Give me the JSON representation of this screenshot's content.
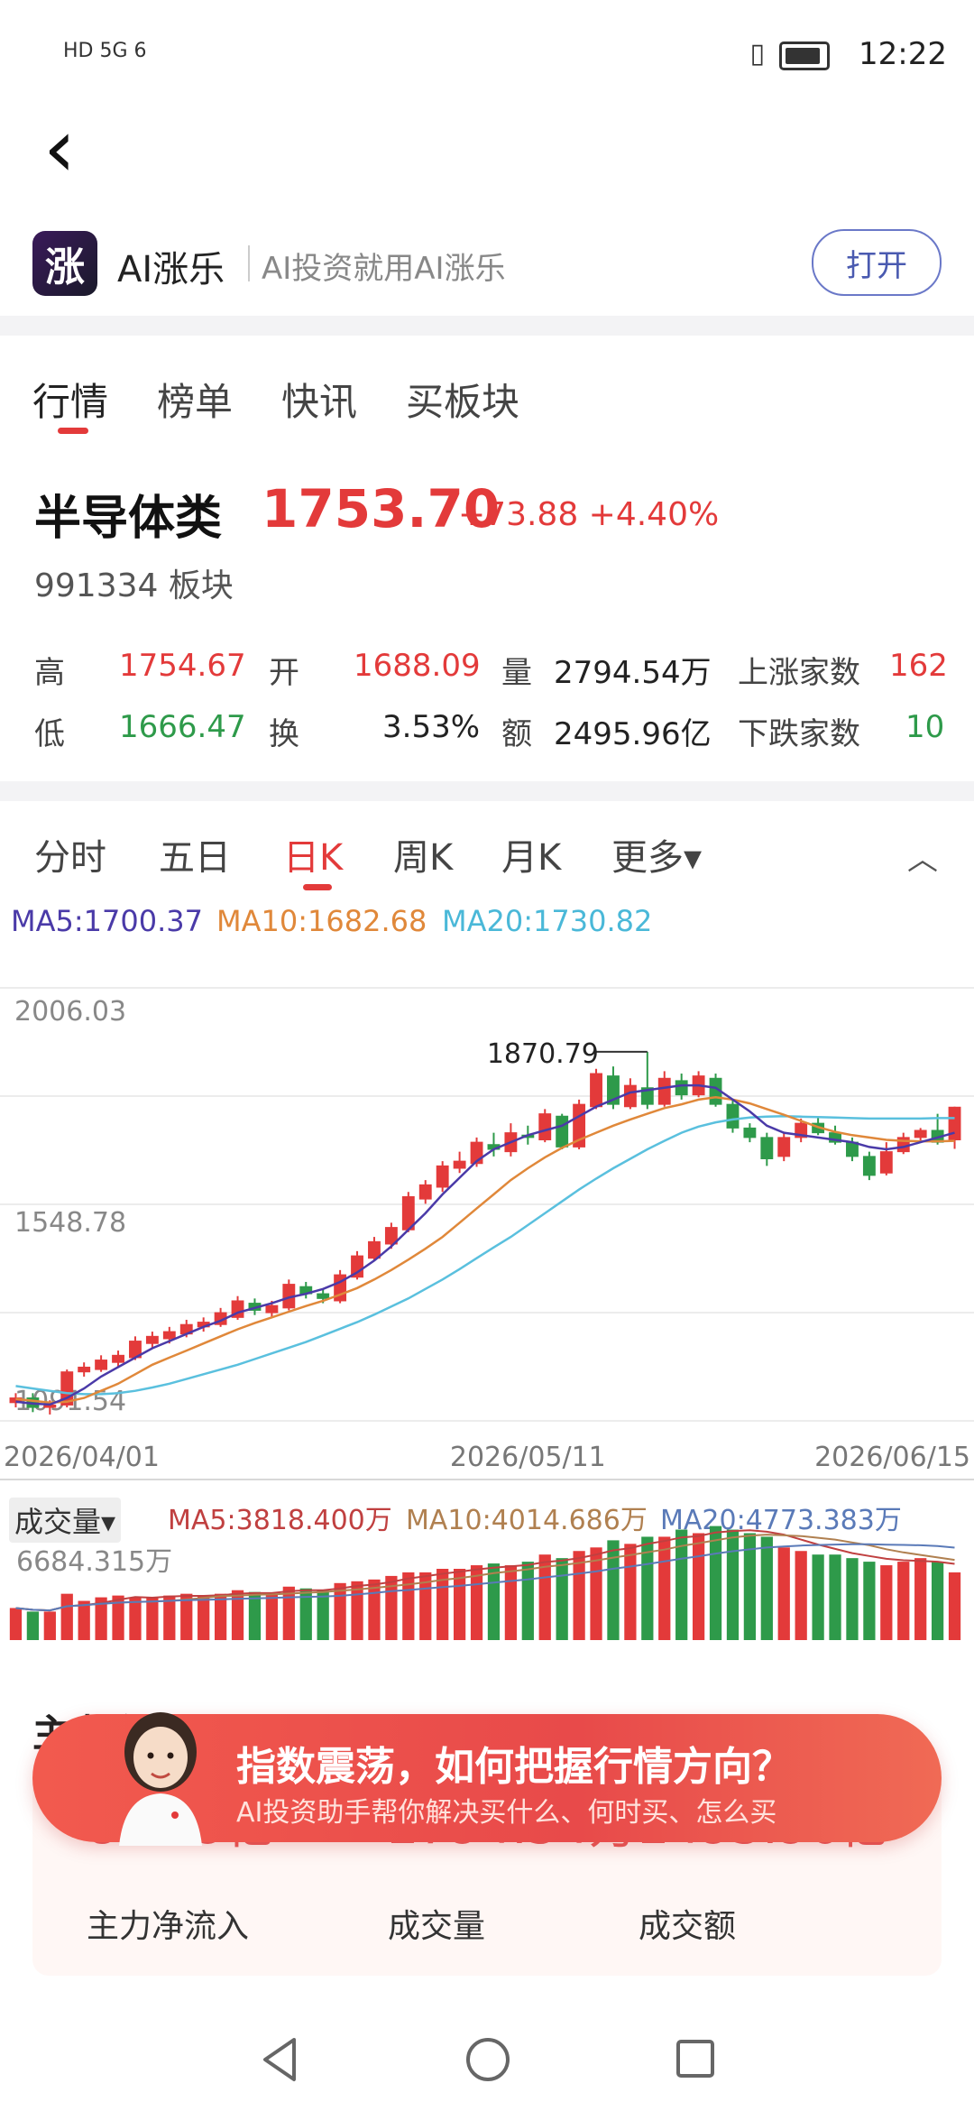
{
  "status": {
    "left_icons": "HD 5G 6",
    "time": "12:22"
  },
  "app": {
    "logo_text": "涨",
    "name": "AI涨乐",
    "slogan": "AI投资就用AI涨乐",
    "open_button": "打开"
  },
  "tabs": [
    "行情",
    "榜单",
    "快讯",
    "买板块"
  ],
  "quote": {
    "name": "半导体类",
    "price": "1753.70",
    "change": "+73.88 +4.40%",
    "code_line": "991334 板块",
    "stats": [
      {
        "label": "高",
        "value": "1754.67",
        "color": "red"
      },
      {
        "label": "开",
        "value": "1688.09",
        "color": "red"
      },
      {
        "label": "量",
        "value": "2794.54万",
        "color": "dark"
      },
      {
        "label": "上涨家数",
        "value": "162",
        "color": "red"
      },
      {
        "label": "低",
        "value": "1666.47",
        "color": "green"
      },
      {
        "label": "换",
        "value": "3.53%",
        "color": "dark"
      },
      {
        "label": "额",
        "value": "2495.96亿",
        "color": "dark"
      },
      {
        "label": "下跌家数",
        "value": "10",
        "color": "green"
      }
    ]
  },
  "chart_tabs": [
    "分时",
    "五日",
    "日K",
    "周K",
    "月K",
    "更多▾"
  ],
  "ma": {
    "ma5": "MA5:1700.37",
    "ma10": "MA10:1682.68",
    "ma20": "MA20:1730.82"
  },
  "chart_data": {
    "type": "candlestick",
    "y_labels": [
      "2006.03",
      "1548.78",
      "1091.54"
    ],
    "ylim": [
      1091.54,
      2006.03
    ],
    "high_marker": "1870.79",
    "x_labels": [
      "2026/04/01",
      "2026/05/11",
      "2026/06/15"
    ],
    "candles": [
      [
        1130,
        1140,
        1120,
        1150
      ],
      [
        1140,
        1120,
        1110,
        1150
      ],
      [
        1120,
        1125,
        1105,
        1135
      ],
      [
        1125,
        1195,
        1120,
        1200
      ],
      [
        1195,
        1205,
        1185,
        1215
      ],
      [
        1200,
        1220,
        1195,
        1230
      ],
      [
        1215,
        1230,
        1205,
        1240
      ],
      [
        1225,
        1260,
        1220,
        1270
      ],
      [
        1255,
        1270,
        1245,
        1280
      ],
      [
        1265,
        1280,
        1255,
        1290
      ],
      [
        1275,
        1295,
        1268,
        1305
      ],
      [
        1290,
        1300,
        1280,
        1310
      ],
      [
        1295,
        1320,
        1290,
        1330
      ],
      [
        1310,
        1345,
        1305,
        1355
      ],
      [
        1340,
        1325,
        1315,
        1350
      ],
      [
        1320,
        1335,
        1310,
        1345
      ],
      [
        1330,
        1380,
        1325,
        1390
      ],
      [
        1375,
        1360,
        1350,
        1385
      ],
      [
        1360,
        1350,
        1340,
        1370
      ],
      [
        1345,
        1400,
        1340,
        1410
      ],
      [
        1395,
        1440,
        1390,
        1450
      ],
      [
        1435,
        1470,
        1430,
        1480
      ],
      [
        1465,
        1500,
        1455,
        1510
      ],
      [
        1495,
        1565,
        1490,
        1575
      ],
      [
        1560,
        1590,
        1550,
        1600
      ],
      [
        1585,
        1630,
        1575,
        1640
      ],
      [
        1625,
        1640,
        1615,
        1660
      ],
      [
        1635,
        1680,
        1628,
        1690
      ],
      [
        1675,
        1665,
        1650,
        1700
      ],
      [
        1660,
        1700,
        1650,
        1720
      ],
      [
        1695,
        1690,
        1675,
        1715
      ],
      [
        1685,
        1740,
        1680,
        1750
      ],
      [
        1735,
        1670,
        1665,
        1740
      ],
      [
        1670,
        1760,
        1665,
        1770
      ],
      [
        1755,
        1825,
        1750,
        1835
      ],
      [
        1820,
        1760,
        1750,
        1840
      ],
      [
        1755,
        1800,
        1750,
        1815
      ],
      [
        1795,
        1760,
        1750,
        1871
      ],
      [
        1760,
        1815,
        1755,
        1830
      ],
      [
        1810,
        1780,
        1770,
        1825
      ],
      [
        1780,
        1820,
        1775,
        1830
      ],
      [
        1815,
        1760,
        1755,
        1825
      ],
      [
        1760,
        1710,
        1700,
        1770
      ],
      [
        1710,
        1690,
        1680,
        1720
      ],
      [
        1690,
        1645,
        1630,
        1700
      ],
      [
        1650,
        1690,
        1640,
        1700
      ],
      [
        1690,
        1720,
        1680,
        1730
      ],
      [
        1720,
        1700,
        1695,
        1735
      ],
      [
        1700,
        1680,
        1675,
        1715
      ],
      [
        1680,
        1650,
        1640,
        1690
      ],
      [
        1650,
        1610,
        1600,
        1660
      ],
      [
        1615,
        1660,
        1610,
        1680
      ],
      [
        1660,
        1690,
        1655,
        1700
      ],
      [
        1690,
        1705,
        1680,
        1710
      ],
      [
        1705,
        1680,
        1675,
        1740
      ],
      [
        1685,
        1754,
        1666,
        1755
      ]
    ],
    "ma5": [
      1132,
      1128,
      1126,
      1140,
      1160,
      1185,
      1205,
      1225,
      1245,
      1260,
      1275,
      1290,
      1303,
      1320,
      1330,
      1340,
      1352,
      1360,
      1370,
      1385,
      1405,
      1430,
      1460,
      1495,
      1530,
      1570,
      1605,
      1640,
      1665,
      1680,
      1695,
      1705,
      1715,
      1735,
      1755,
      1770,
      1785,
      1790,
      1795,
      1800,
      1800,
      1795,
      1770,
      1745,
      1715,
      1700,
      1695,
      1690,
      1685,
      1680,
      1670,
      1665,
      1670,
      1680,
      1690,
      1700
    ],
    "ma10": [
      1138,
      1134,
      1130,
      1132,
      1140,
      1155,
      1170,
      1190,
      1210,
      1225,
      1240,
      1255,
      1270,
      1285,
      1298,
      1310,
      1322,
      1334,
      1345,
      1358,
      1372,
      1390,
      1410,
      1432,
      1455,
      1480,
      1510,
      1540,
      1570,
      1600,
      1625,
      1648,
      1668,
      1685,
      1700,
      1715,
      1728,
      1740,
      1752,
      1760,
      1770,
      1775,
      1770,
      1762,
      1750,
      1738,
      1725,
      1712,
      1702,
      1695,
      1690,
      1685,
      1683,
      1682,
      1682,
      1683
    ],
    "ma20": [
      1165,
      1160,
      1155,
      1150,
      1148,
      1148,
      1150,
      1155,
      1162,
      1170,
      1180,
      1190,
      1200,
      1210,
      1222,
      1234,
      1246,
      1258,
      1272,
      1286,
      1300,
      1316,
      1333,
      1350,
      1370,
      1390,
      1412,
      1435,
      1458,
      1480,
      1505,
      1530,
      1555,
      1580,
      1603,
      1625,
      1645,
      1665,
      1683,
      1700,
      1713,
      1722,
      1728,
      1732,
      1734,
      1735,
      1734,
      1733,
      1732,
      1731,
      1730,
      1730,
      1730,
      1730,
      1731,
      1731
    ]
  },
  "volume": {
    "label": "成交量▾",
    "ma5": "MA5:3818.400万",
    "ma10": "MA10:4014.686万",
    "ma20": "MA20:4773.383万",
    "max": "6684.315万",
    "values": [
      18,
      16,
      16,
      26,
      22,
      24,
      25,
      24,
      24,
      25,
      26,
      25,
      26,
      28,
      27,
      26,
      30,
      29,
      28,
      32,
      33,
      34,
      36,
      38,
      38,
      40,
      40,
      42,
      43,
      42,
      44,
      48,
      46,
      50,
      52,
      56,
      54,
      58,
      58,
      62,
      60,
      64,
      62,
      60,
      58,
      52,
      50,
      48,
      48,
      46,
      44,
      42,
      44,
      46,
      44,
      38
    ]
  },
  "lower": {
    "partial_title": "主力净",
    "stats": [
      {
        "value": "89.89亿",
        "label": "主力净流入"
      },
      {
        "value": "2794.54万",
        "label": "成交量"
      },
      {
        "value": "2495.96亿",
        "label": "成交额"
      }
    ]
  },
  "banner": {
    "title": "指数震荡，如何把握行情方向？",
    "subtitle": "AI投资助手帮你解决买什么、何时买、怎么买"
  }
}
